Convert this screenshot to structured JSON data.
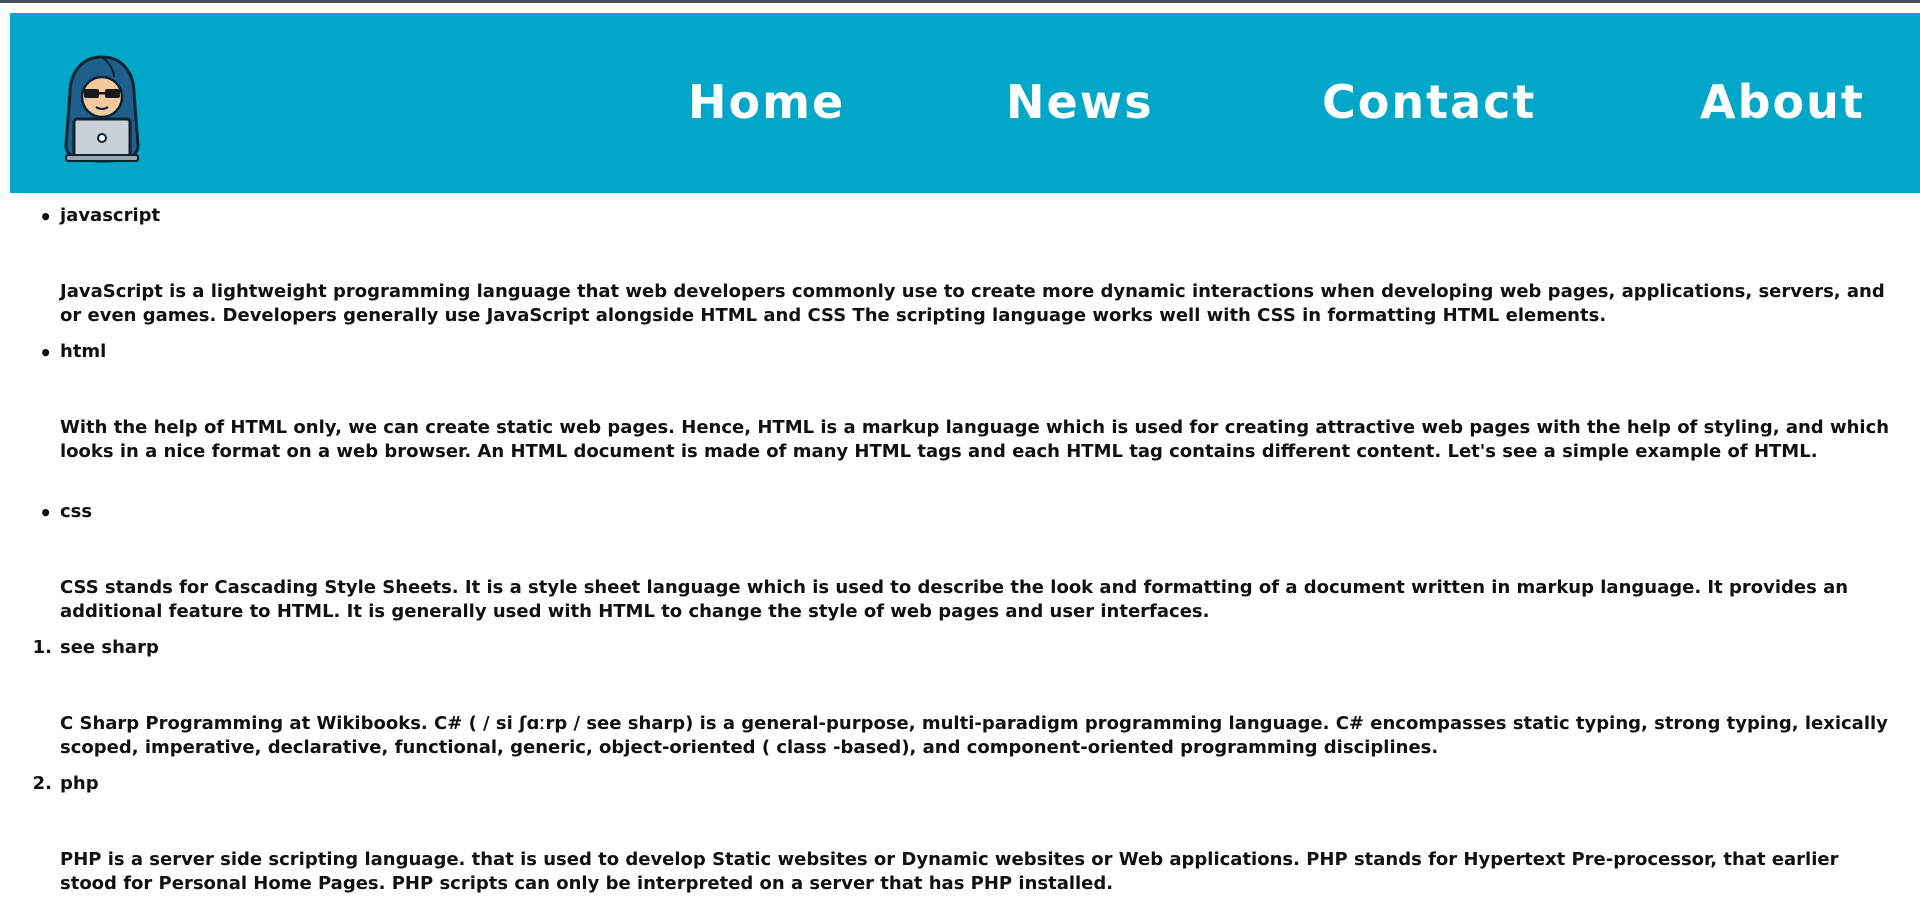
{
  "nav": {
    "home": "Home",
    "news": "News",
    "contact": "Contact",
    "about": "About"
  },
  "logo": {
    "icon": "hacker-laptop-icon"
  },
  "colors": {
    "header_bg": "#00a7c8",
    "nav_text": "#ffffff",
    "body_text": "#111111"
  },
  "unordered": [
    {
      "marker": "•",
      "term": "javascript",
      "description": "JavaScript is a lightweight programming language that web developers commonly use to create more dynamic interactions when developing web pages, applications, servers, and or even games. Developers generally use JavaScript alongside HTML and CSS The scripting language works well with CSS in formatting HTML elements."
    },
    {
      "marker": "•",
      "term": "html",
      "description": "With the help of HTML only, we can create static web pages. Hence, HTML is a markup language which is used for creating attractive web pages with the help of styling, and which looks in a nice format on a web browser. An HTML document is made of many HTML tags and each HTML tag contains different content. Let's see a simple example of HTML."
    },
    {
      "marker": "•",
      "term": "css",
      "description": "CSS stands for Cascading Style Sheets. It is a style sheet language which is used to describe the look and formatting of a document written in markup language. It provides an additional feature to HTML. It is generally used with HTML to change the style of web pages and user interfaces."
    }
  ],
  "ordered": [
    {
      "marker": "1.",
      "term": "see sharp",
      "description": "C Sharp Programming at Wikibooks. C# ( / si ʃɑːrp / see sharp) is a general-purpose, multi-paradigm programming language. C# encompasses static typing, strong typing, lexically scoped, imperative, declarative, functional, generic, object-oriented ( class -based), and component-oriented programming disciplines."
    },
    {
      "marker": "2.",
      "term": "php",
      "description": "PHP is a server side scripting language. that is used to develop Static websites or Dynamic websites or Web applications. PHP stands for Hypertext Pre-processor, that earlier stood for Personal Home Pages. PHP scripts can only be interpreted on a server that has PHP installed."
    }
  ]
}
